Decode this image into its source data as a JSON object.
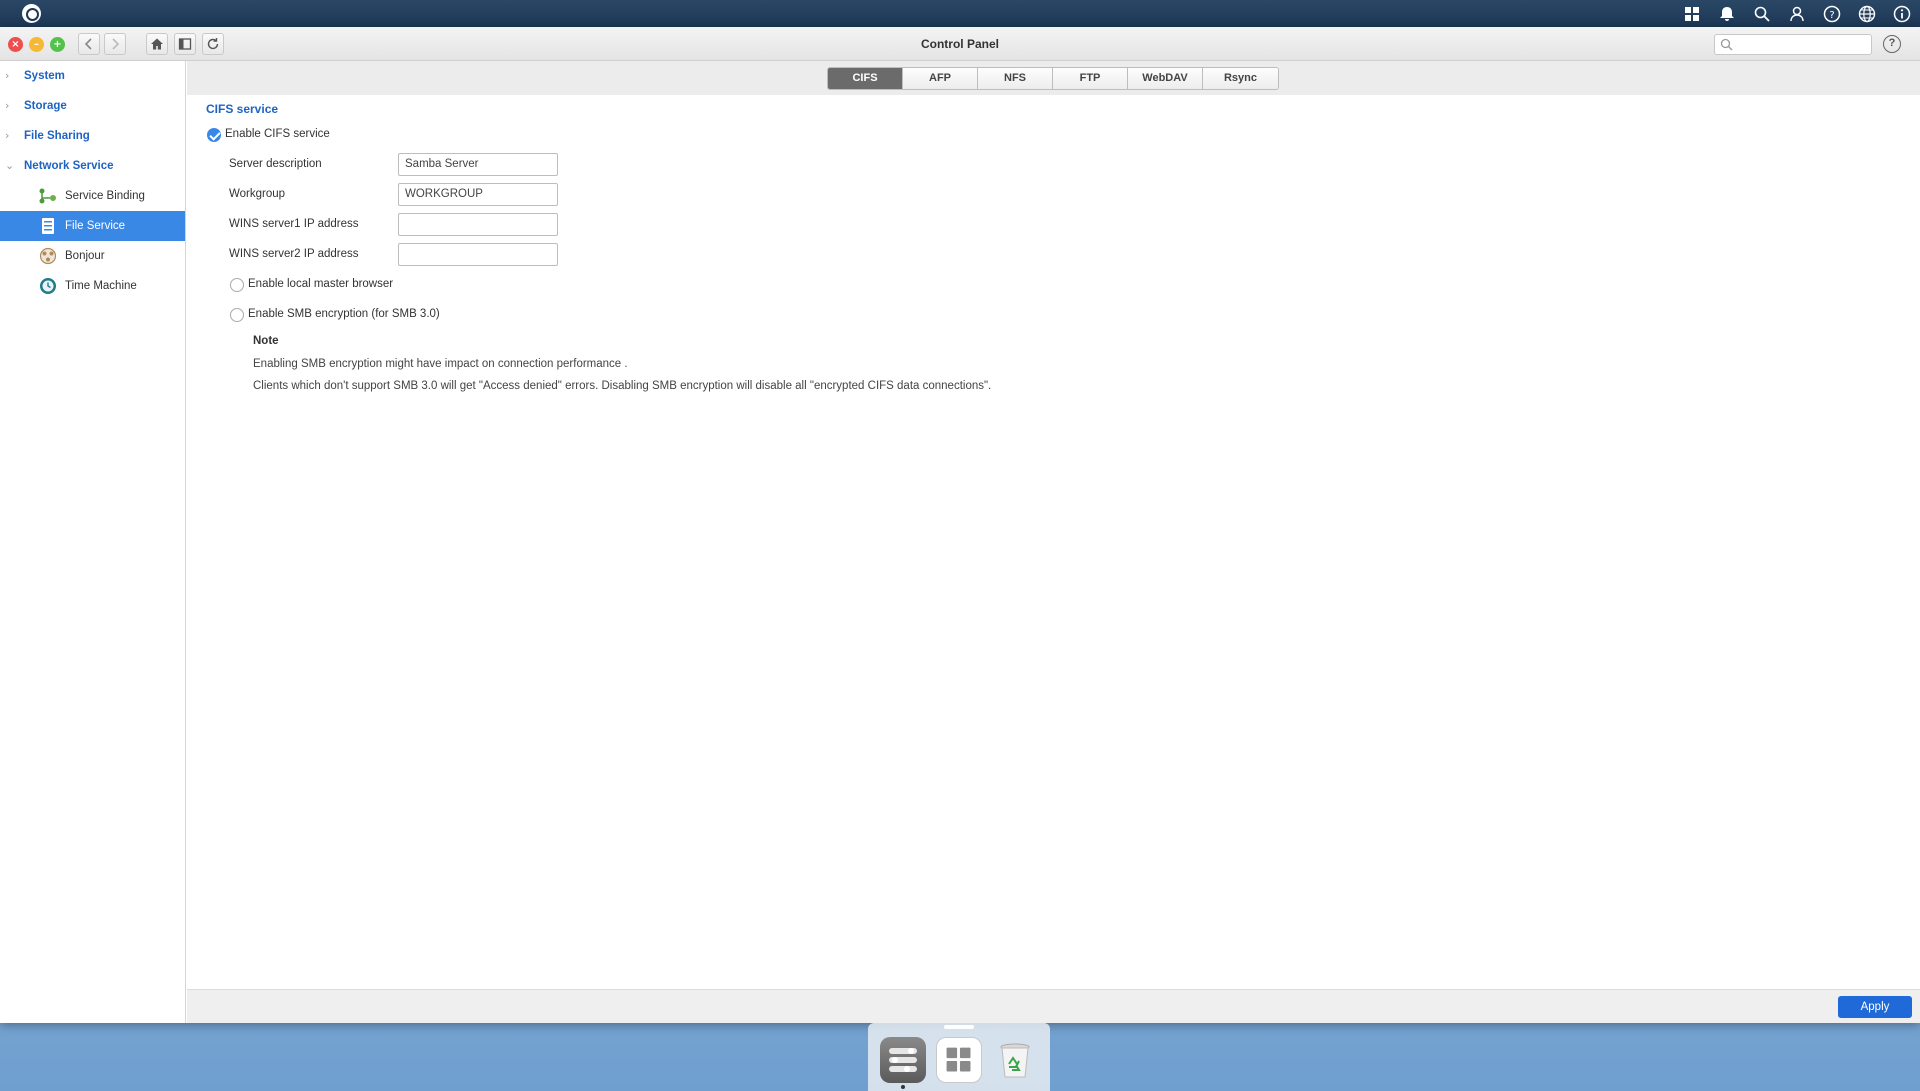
{
  "window": {
    "title": "Control Panel"
  },
  "topbar_icons": [
    "apps-grid-icon",
    "bell-icon",
    "search-icon",
    "user-icon",
    "help-icon",
    "globe-icon",
    "info-icon"
  ],
  "sidebar": {
    "items": [
      {
        "label": "System",
        "expanded": false
      },
      {
        "label": "Storage",
        "expanded": false
      },
      {
        "label": "File Sharing",
        "expanded": false
      },
      {
        "label": "Network Service",
        "expanded": true
      }
    ],
    "subitems": [
      {
        "label": "Service Binding",
        "icon": "service-binding-icon",
        "active": false
      },
      {
        "label": "File Service",
        "icon": "file-service-icon",
        "active": true
      },
      {
        "label": "Bonjour",
        "icon": "bonjour-icon",
        "active": false
      },
      {
        "label": "Time Machine",
        "icon": "time-machine-icon",
        "active": false
      }
    ]
  },
  "tabs": [
    "CIFS",
    "AFP",
    "NFS",
    "FTP",
    "WebDAV",
    "Rsync"
  ],
  "active_tab": "CIFS",
  "cifs": {
    "section_title": "CIFS service",
    "enable_label": "Enable CIFS service",
    "enabled": true,
    "fields": [
      {
        "label": "Server description",
        "value": "Samba Server"
      },
      {
        "label": "Workgroup",
        "value": "WORKGROUP"
      },
      {
        "label": "WINS server1 IP address",
        "value": ""
      },
      {
        "label": "WINS server2 IP address",
        "value": ""
      }
    ],
    "local_master_label": "Enable local master browser",
    "local_master_checked": false,
    "smb_encryption_label": "Enable SMB encryption (for SMB 3.0)",
    "smb_encryption_checked": false,
    "note_title": "Note",
    "note_lines": [
      "Enabling SMB encryption might have impact on connection performance .",
      "Clients which don't support SMB 3.0 will get \"Access denied\" errors. Disabling SMB encryption will disable all \"encrypted CIFS data connections\"."
    ]
  },
  "footer": {
    "apply_label": "Apply"
  },
  "colors": {
    "accent": "#3a88e6",
    "link": "#1f63c2",
    "apply": "#1f6ad8"
  }
}
